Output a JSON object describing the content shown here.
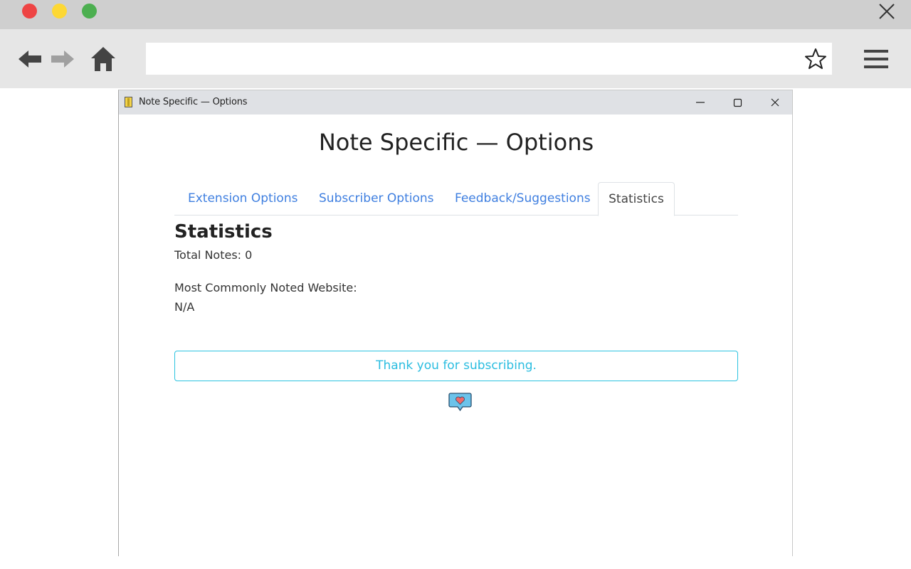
{
  "browser": {
    "url_value": "",
    "icons": {
      "back": "arrow-left-icon",
      "forward": "arrow-right-icon",
      "home": "home-icon",
      "bookmark": "star-icon",
      "menu": "hamburger-menu-icon",
      "close": "close-icon"
    },
    "colors": {
      "close_dot": "#ee4444",
      "minimize_dot": "#fdd835",
      "maximize_dot": "#4caf50"
    }
  },
  "popup": {
    "window_title": "Note Specific — Options",
    "page_title": "Note Specific — Options",
    "tabs": [
      {
        "label": "Extension Options",
        "active": false
      },
      {
        "label": "Subscriber Options",
        "active": false
      },
      {
        "label": "Feedback/Suggestions",
        "active": false
      },
      {
        "label": "Statistics",
        "active": true
      }
    ],
    "statistics": {
      "heading": "Statistics",
      "total_notes": "Total Notes: 0",
      "most_common_label": "Most Commonly Noted Website:",
      "most_common_value": "N/A"
    },
    "subscription_message": "Thank you for subscribing.",
    "feedback_icon": "heart-speech-bubble-icon",
    "colors": {
      "tab_link": "#3f7fe0",
      "alert": "#2bbde0"
    }
  }
}
